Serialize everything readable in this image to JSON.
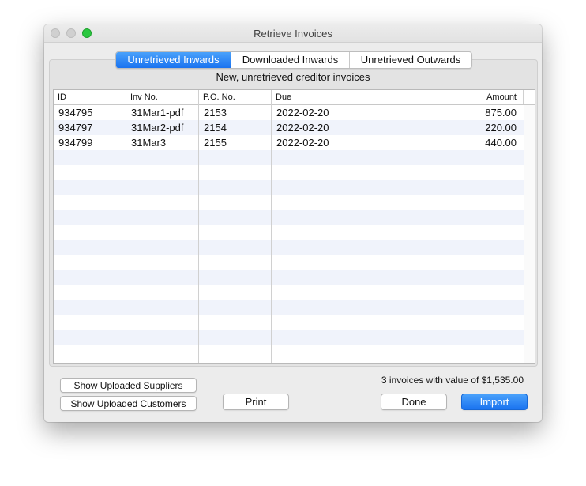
{
  "window": {
    "title": "Retrieve Invoices"
  },
  "tabs": [
    {
      "label": "Unretrieved Inwards",
      "active": true
    },
    {
      "label": "Downloaded Inwards",
      "active": false
    },
    {
      "label": "Unretrieved Outwards",
      "active": false
    }
  ],
  "subtitle": "New, unretrieved creditor invoices",
  "table": {
    "columns": [
      "ID",
      "Inv No.",
      "P.O. No.",
      "Due",
      "Amount"
    ],
    "rows": [
      {
        "id": "934795",
        "inv_no": "31Mar1-pdf",
        "po_no": "2153",
        "due": "2022-02-20",
        "amount": "875.00"
      },
      {
        "id": "934797",
        "inv_no": "31Mar2-pdf",
        "po_no": "2154",
        "due": "2022-02-20",
        "amount": "220.00"
      },
      {
        "id": "934799",
        "inv_no": "31Mar3",
        "po_no": "2155",
        "due": "2022-02-20",
        "amount": "440.00"
      }
    ]
  },
  "summary": "3 invoices with value of $1,535.00",
  "buttons": {
    "show_suppliers": "Show Uploaded Suppliers",
    "show_customers": "Show Uploaded Customers",
    "print": "Print",
    "done": "Done",
    "import": "Import"
  },
  "colors": {
    "accent": "#1a73f0",
    "row_stripe": "#f0f3fb",
    "zoom_button": "#2bc840"
  },
  "icons": {
    "close": "close-icon",
    "minimize": "minimize-icon",
    "zoom": "zoom-icon"
  }
}
